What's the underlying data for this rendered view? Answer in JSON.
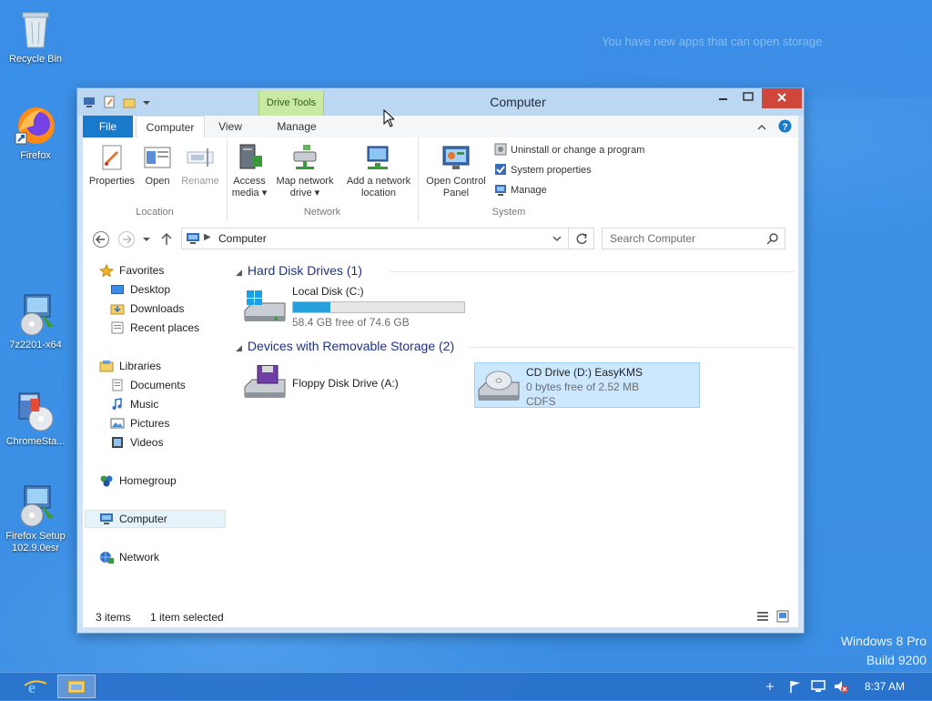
{
  "desktop": {
    "icons": [
      {
        "label": "Recycle Bin"
      },
      {
        "label": "Firefox"
      },
      {
        "label": "7z2201-x64"
      },
      {
        "label": "ChromeSta..."
      },
      {
        "label": "Firefox Setup 102.9.0esr"
      }
    ],
    "notification": "You have new apps that can open storage",
    "watermark": {
      "line1": "Windows 8 Pro",
      "line2": "Build 9200"
    }
  },
  "taskbar": {
    "clock": "8:37 AM"
  },
  "window": {
    "title": "Computer",
    "context_tab": "Drive Tools",
    "tabs": {
      "file": "File",
      "computer": "Computer",
      "view": "View",
      "manage": "Manage"
    },
    "ribbon": {
      "location": {
        "label": "Location",
        "properties": "Properties",
        "open": "Open",
        "rename": "Rename"
      },
      "network": {
        "label": "Network",
        "access_media": "Access media",
        "map_drive": "Map network drive",
        "add_location": "Add a network location"
      },
      "system": {
        "label": "System",
        "control_panel": "Open Control Panel",
        "uninstall": "Uninstall or change a program",
        "sys_props": "System properties",
        "manage": "Manage"
      }
    },
    "address": {
      "crumb": "Computer"
    },
    "search": {
      "placeholder": "Search Computer"
    },
    "nav": {
      "favorites": "Favorites",
      "desktop": "Desktop",
      "downloads": "Downloads",
      "recent": "Recent places",
      "libraries": "Libraries",
      "documents": "Documents",
      "music": "Music",
      "pictures": "Pictures",
      "videos": "Videos",
      "homegroup": "Homegroup",
      "computer": "Computer",
      "network": "Network"
    },
    "groups": {
      "hdd": {
        "title": "Hard Disk Drives (1)"
      },
      "removable": {
        "title": "Devices with Removable Storage (2)"
      }
    },
    "drives": {
      "c": {
        "name": "Local Disk (C:)",
        "free": "58.4 GB free of 74.6 GB",
        "used_fraction": 0.22
      },
      "a": {
        "name": "Floppy Disk Drive (A:)"
      },
      "d": {
        "name": "CD Drive (D:) EasyKMS",
        "free": "0 bytes free of 2.52 MB",
        "fs": "CDFS"
      }
    },
    "status": {
      "items": "3 items",
      "selected": "1 item selected"
    }
  }
}
